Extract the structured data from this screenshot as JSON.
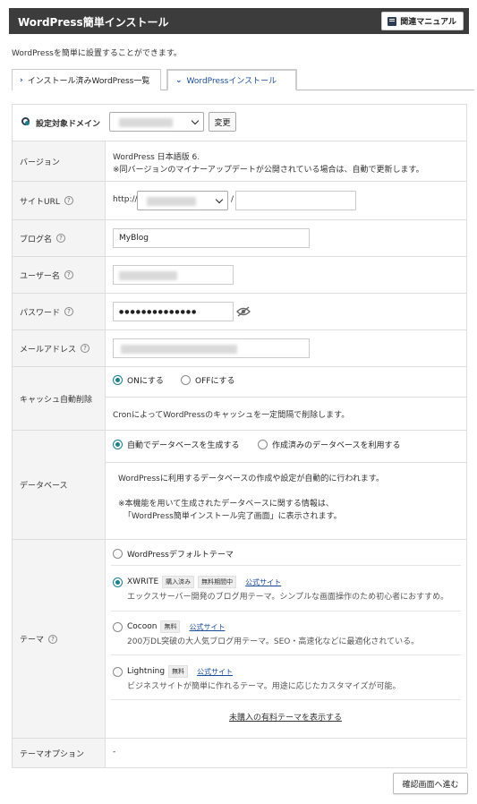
{
  "header": {
    "title": "WordPress簡単インストール",
    "manual_label": "関連マニュアル"
  },
  "description": "WordPressを簡単に設置することができます。",
  "tabs": [
    {
      "label": "インストール済みWordPress一覧",
      "icon": "chevron-right-icon"
    },
    {
      "label": "WordPressインストール",
      "icon": "chevron-down-icon",
      "active": true
    }
  ],
  "form": {
    "target_domain": {
      "label": "設定対象ドメイン",
      "button": "変更"
    },
    "version": {
      "label": "バージョン",
      "value": "WordPress 日本語版 6.",
      "note": "※同バージョンのマイナーアップデートが公開されている場合は、自動で更新します。"
    },
    "site_url": {
      "label": "サイトURL",
      "prefix": "http://",
      "separator": "/"
    },
    "blog_name": {
      "label": "ブログ名",
      "value": "MyBlog"
    },
    "username": {
      "label": "ユーザー名"
    },
    "password": {
      "label": "パスワード",
      "value": "●●●●●●●●●●●●●●"
    },
    "email": {
      "label": "メールアドレス"
    },
    "cache": {
      "label": "キャッシュ自動削除",
      "on": "ONにする",
      "off": "OFFにする",
      "note": "CronによってWordPressのキャッシュを一定間隔で削除します。"
    },
    "database": {
      "label": "データベース",
      "auto": "自動でデータベースを生成する",
      "existing": "作成済みのデータベースを利用する",
      "note1": "WordPressに利用するデータベースの作成や設定が自動的に行われます。",
      "note2": "※本機能を用いて生成されたデータベースに関する情報は、",
      "note3": "「WordPress簡単インストール完了画面」に表示されます。"
    },
    "theme": {
      "label": "テーマ",
      "default": "WordPressデフォルトテーマ",
      "xwrite": {
        "name": "XWRITE",
        "badge1": "購入済み",
        "badge2": "無料期間中",
        "link": "公式サイト",
        "desc": "エックスサーバー開発のブログ用テーマ。シンプルな画面操作のため初心者におすすめ。"
      },
      "cocoon": {
        "name": "Cocoon",
        "badge": "無料",
        "link": "公式サイト",
        "desc": "200万DL突破の大人気ブログ用テーマ。SEO・高速化などに最適化されている。"
      },
      "lightning": {
        "name": "Lightning",
        "badge": "無料",
        "link": "公式サイト",
        "desc": "ビジネスサイトが簡単に作れるテーマ。用途に応じたカスタマイズが可能。"
      },
      "more_link": "未購入の有料テーマを表示する"
    },
    "theme_option": {
      "label": "テーマオプション",
      "value": "-"
    }
  },
  "confirm_button": "確認画面へ進む",
  "colors": {
    "header_bg": "#3c3c3c",
    "accent": "#1a7f8e",
    "link": "#1a4d99"
  }
}
